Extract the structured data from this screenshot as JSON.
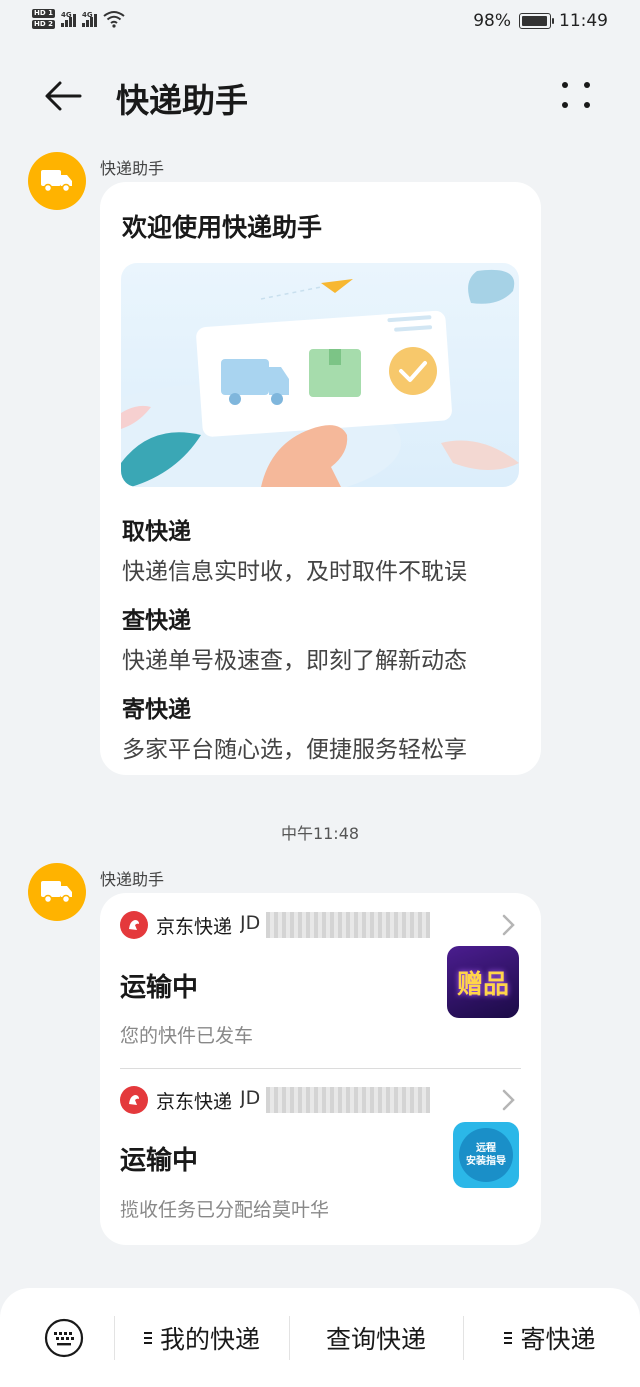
{
  "status_bar": {
    "hd1": "HD 1",
    "hd2": "HD 2",
    "network1": "4G",
    "network2": "4G",
    "battery_percent": "98%",
    "battery_level": 0.98,
    "time": "11:49"
  },
  "header": {
    "title": "快递助手",
    "back_icon": "arrow-left-icon",
    "more_icon": "four-dot-menu-icon"
  },
  "welcome_message": {
    "sender": "快递助手",
    "title": "欢迎使用快递助手",
    "features": [
      {
        "heading": "取快递",
        "description": "快递信息实时收，及时取件不耽误"
      },
      {
        "heading": "查快递",
        "description": "快递单号极速查，即刻了解新动态"
      },
      {
        "heading": "寄快递",
        "description": "多家平台随心选，便捷服务轻松享"
      }
    ]
  },
  "timestamp": "中午11:48",
  "package_message": {
    "sender": "快递助手",
    "packages": [
      {
        "courier": "京东快递",
        "tracking_visible": "JD",
        "status": "运输中",
        "description": "您的快件已发车",
        "thumbnail_text": "赠品"
      },
      {
        "courier": "京东快递",
        "tracking_visible": "JD",
        "status": "运输中",
        "description": "揽收任务已分配给莫叶华",
        "thumbnail_text_1": "远程",
        "thumbnail_text_2": "安装指导"
      }
    ]
  },
  "bottom_bar": {
    "keyboard_icon": "keyboard-icon",
    "items": [
      {
        "label": "我的快递",
        "has_menu": true
      },
      {
        "label": "查询快递",
        "has_menu": false
      },
      {
        "label": "寄快递",
        "has_menu": true
      }
    ]
  },
  "colors": {
    "avatar": "#ffb300",
    "jd_red": "#e4393c",
    "background": "#f1f3f5"
  }
}
